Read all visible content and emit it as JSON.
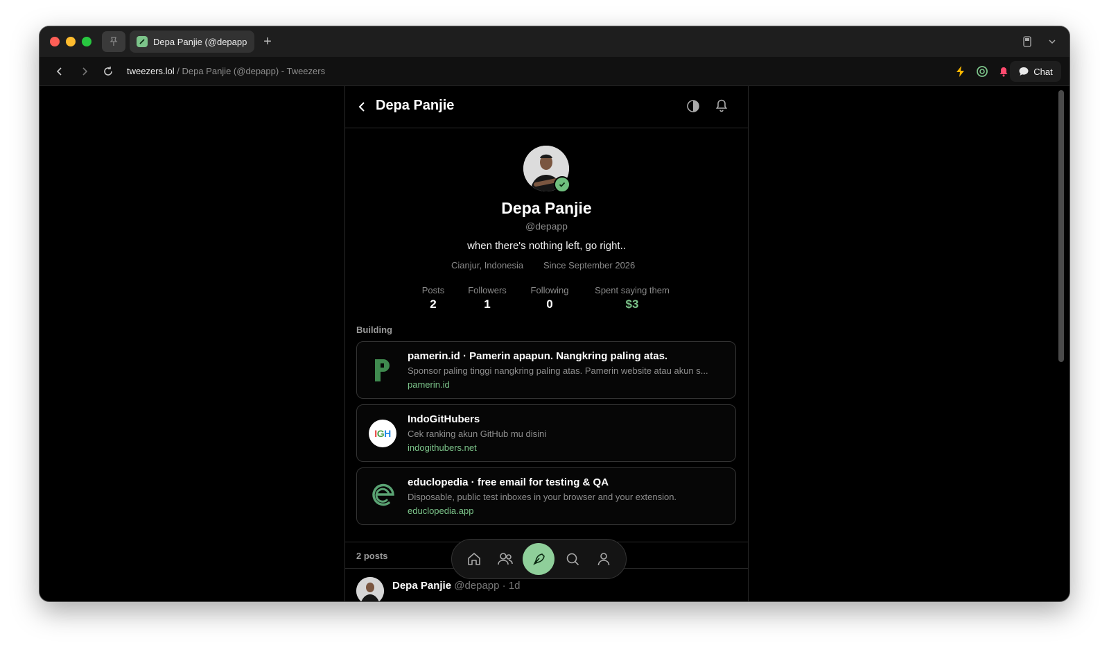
{
  "browser": {
    "tab_title": "Depa Panjie (@depapp",
    "url_host": "tweezers.lol",
    "url_rest": " / Depa Panjie (@depapp) - Tweezers",
    "chat_label": "Chat"
  },
  "header": {
    "title": "Depa Panjie"
  },
  "profile": {
    "name": "Depa Panjie",
    "handle": "@depapp",
    "bio": "when there's nothing left, go right..",
    "location": "Cianjur, Indonesia",
    "since": "Since September 2026",
    "stats": [
      {
        "label": "Posts",
        "value": "2"
      },
      {
        "label": "Followers",
        "value": "1"
      },
      {
        "label": "Following",
        "value": "0"
      },
      {
        "label": "Spent saying them",
        "value": "$3"
      }
    ]
  },
  "building": {
    "heading": "Building",
    "projects": [
      {
        "title": "pamerin.id · Pamerin apapun. Nangkring paling atas.",
        "desc": "Sponsor paling tinggi nangkring paling atas. Pamerin website atau akun s...",
        "link": "pamerin.id",
        "icon": "pamerin-logo-icon"
      },
      {
        "title": "IndoGitHubers",
        "desc": "Cek ranking akun GitHub mu disini",
        "link": "indogithubers.net",
        "icon": "igh-logo-icon",
        "icon_text": "IGH"
      },
      {
        "title": "educlopedia · free email for testing & QA",
        "desc": "Disposable, public test inboxes in your browser and your extension.",
        "link": "educlopedia.app",
        "icon": "educlopedia-logo-icon"
      }
    ]
  },
  "posts": {
    "count_label": "2 posts",
    "first_author": "Depa Panjie",
    "first_meta": " @depapp · 1d"
  },
  "colors": {
    "accent": "#7cc48a",
    "background": "#000000"
  }
}
